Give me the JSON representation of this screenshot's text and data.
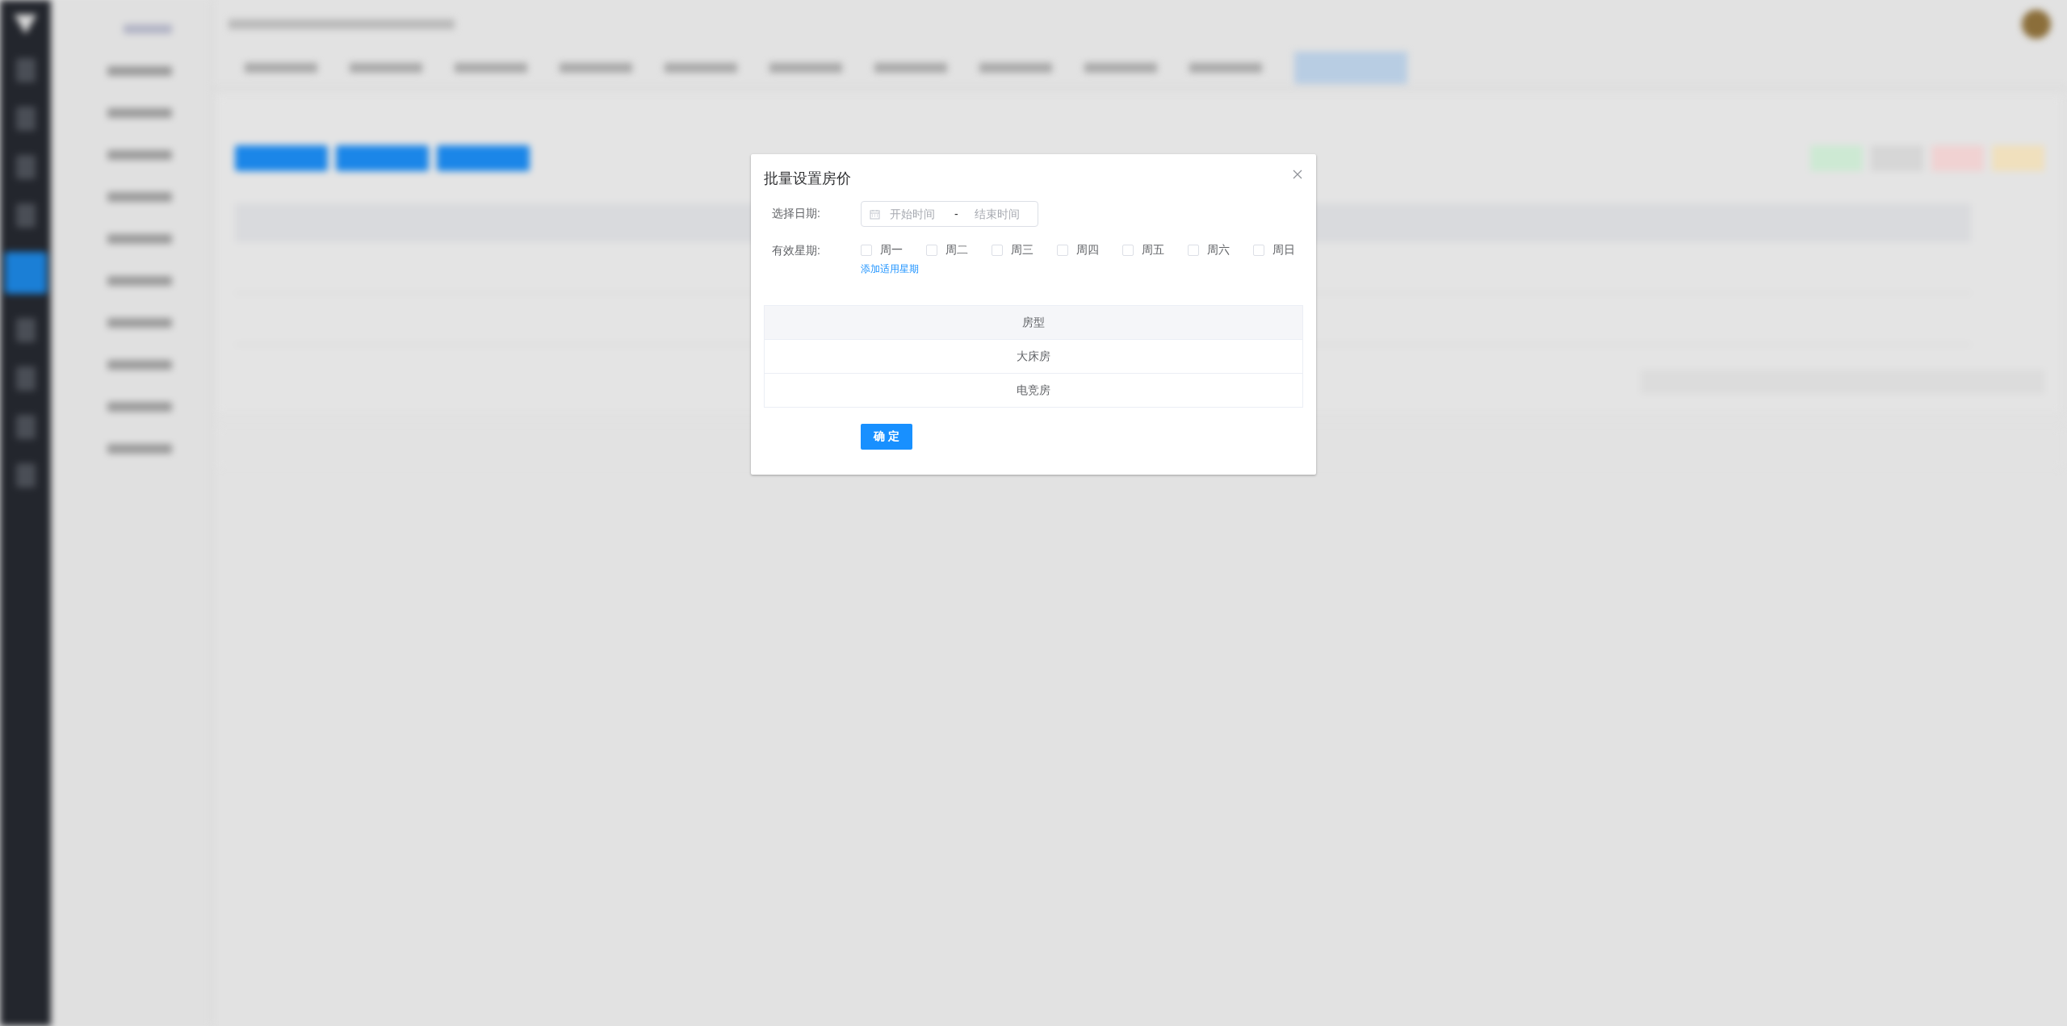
{
  "dialog": {
    "title": "批量设置房价",
    "date_label": "选择日期:",
    "date_range": {
      "start_placeholder": "开始时间",
      "separator": "-",
      "end_placeholder": "结束时间"
    },
    "week_label": "有效星期:",
    "weekdays": [
      {
        "label": "周一",
        "checked": false
      },
      {
        "label": "周二",
        "checked": false
      },
      {
        "label": "周三",
        "checked": false
      },
      {
        "label": "周四",
        "checked": false
      },
      {
        "label": "周五",
        "checked": false
      },
      {
        "label": "周六",
        "checked": false
      },
      {
        "label": "周日",
        "checked": false
      }
    ],
    "add_link": "添加适用星期",
    "table": {
      "columns": [
        "房型"
      ],
      "rows": [
        [
          "大床房"
        ],
        [
          "电竞房"
        ]
      ]
    },
    "confirm_button": "确 定"
  }
}
